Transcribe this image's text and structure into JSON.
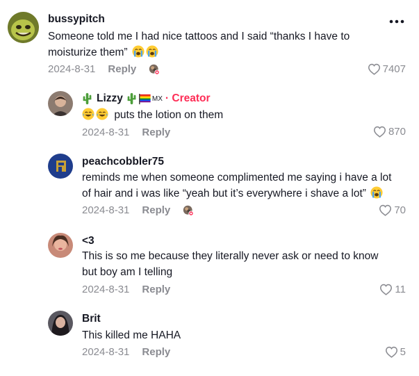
{
  "comments": [
    {
      "username": "bussypitch",
      "text1": "Someone told me I had nice tattoos and I said “thanks I have to",
      "text2": "moisturize them”",
      "date": "2024-8-31",
      "reply": "Reply",
      "likes": "7407"
    },
    {
      "username": "Lizzy",
      "flag_code": "MX",
      "badge": "· Creator",
      "text1": "puts the lotion on them",
      "date": "2024-8-31",
      "reply": "Reply",
      "likes": "870"
    },
    {
      "username": "peachcobbler75",
      "text1": "reminds me when someone complimented me saying i have a lot",
      "text2": "of hair and i was like “yeah but it’s everywhere i shave a lot”",
      "date": "2024-8-31",
      "reply": "Reply",
      "likes": "70"
    },
    {
      "username": "<3",
      "text1": "This is so me because they literally never ask or need to know",
      "text2": "but boy am I telling",
      "date": "2024-8-31",
      "reply": "Reply",
      "likes": "11"
    },
    {
      "username": "Brit",
      "text1": "This killed me HAHA",
      "date": "2024-8-31",
      "reply": "Reply",
      "likes": "5"
    }
  ],
  "icons": {
    "more": "more-horizontal-icon",
    "like": "heart-outline-icon",
    "crying": "loudly-crying-face-emoji",
    "joy": "face-with-tears-of-joy-emoji",
    "cactus": "cactus-emoji",
    "flag": "rainbow-flag-emoji"
  },
  "colors": {
    "creator": "#fe2c55",
    "meta": "#8a8b91",
    "text": "#161823"
  }
}
